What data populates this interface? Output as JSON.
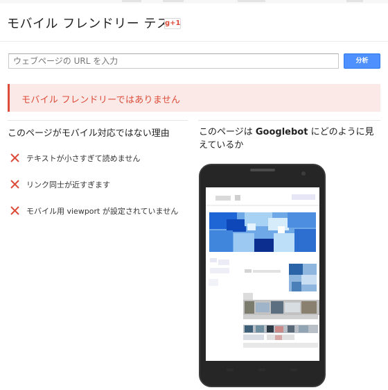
{
  "page": {
    "title": "モバイル フレンドリー テスト",
    "gplus_label": "g+1"
  },
  "search": {
    "placeholder": "ウェブページの URL を入力",
    "button_label": "分析"
  },
  "alert": {
    "message": "モバイル フレンドリーではありません",
    "color": "#dd4b39",
    "background": "#fbe9e7"
  },
  "reasons": {
    "heading": "このページがモバイル対応ではない理由",
    "items": [
      {
        "icon": "red-x-icon",
        "text": "テキストが小さすぎて読めません"
      },
      {
        "icon": "red-x-icon",
        "text": "リンク同士が近すぎます"
      },
      {
        "icon": "red-x-icon",
        "text": "モバイル用 viewport が設定されていません"
      }
    ]
  },
  "preview": {
    "heading_prefix": "このページは ",
    "heading_bot": "Googlebot",
    "heading_suffix": " にどのように見えているか",
    "device_icon": "smartphone-icon"
  },
  "colors": {
    "accent_blue": "#4d90fe",
    "error_red": "#dd4b39",
    "phone_body": "#262626"
  }
}
